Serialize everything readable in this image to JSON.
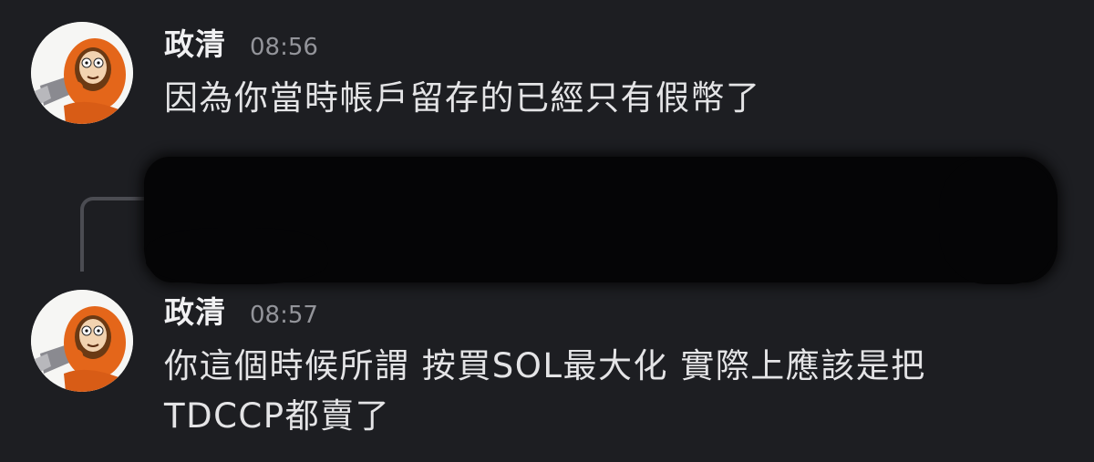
{
  "messages": [
    {
      "author": "政清",
      "time": "08:56",
      "text": "因為你當時帳戶留存的已經只有假幣了"
    },
    {
      "author": "政清",
      "time": "08:57",
      "text": "你這個時候所謂 按買SOL最大化 實際上應該是把\nTDCCP都賣了"
    }
  ],
  "icons": {
    "avatar": "kenny-avatar",
    "reply": "reply-connector",
    "redaction": "redacted-reply-preview"
  },
  "colors": {
    "background": "#1d1e22",
    "text": "#e4e4e6",
    "timestamp": "#93949a",
    "avatar_parka": "#e4661a"
  }
}
